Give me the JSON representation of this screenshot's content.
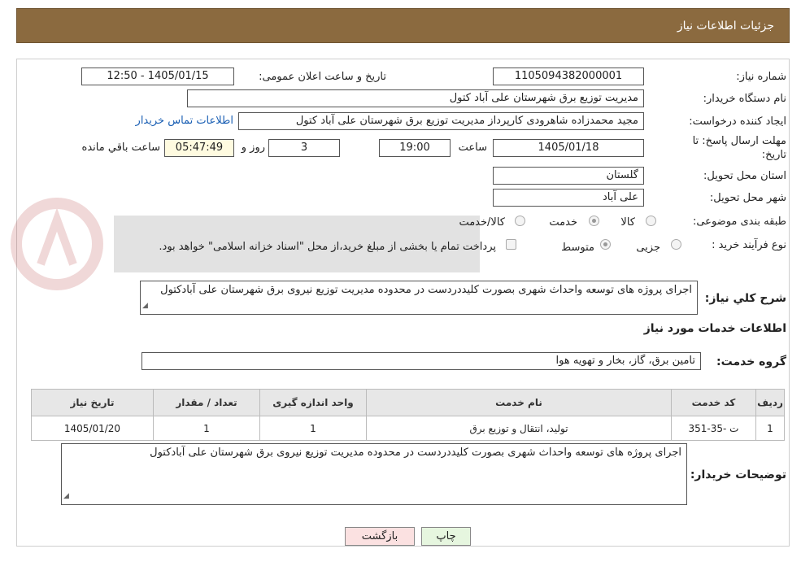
{
  "header": {
    "title": "جزئیات اطلاعات نیاز"
  },
  "form": {
    "need_number": {
      "label": "شماره نیاز:",
      "value": "1105094382000001"
    },
    "announce": {
      "label": "تاریخ و ساعت اعلان عمومی:",
      "value": "1405/01/15 - 12:50"
    },
    "buyer_org": {
      "label": "نام دستگاه خریدار:",
      "value": "مدیریت توزیع برق شهرستان علی آباد کتول"
    },
    "requester": {
      "label": "ایجاد کننده درخواست:",
      "value": "مجید محمدزاده شاهرودی کارپرداز مدیریت توزیع برق شهرستان علی آباد کتول",
      "contact_link": "اطلاعات تماس خریدار"
    },
    "deadline": {
      "label_line1": "مهلت ارسال پاسخ: تا",
      "label_line2": "تاریخ:",
      "date": "1405/01/18",
      "time_label": "ساعت",
      "time": "19:00",
      "days": "3",
      "days_label": "روز و",
      "remaining": "05:47:49",
      "remaining_label": "ساعت باقي مانده"
    },
    "province": {
      "label": "استان محل تحویل:",
      "value": "گلستان"
    },
    "city": {
      "label": "شهر محل تحویل:",
      "value": "علی آباد"
    },
    "category": {
      "label": "طبقه بندی موضوعی:",
      "options": [
        "کالا",
        "خدمت",
        "کالا/خدمت"
      ]
    },
    "purchase_type": {
      "label": "نوع فرآیند خرید :",
      "options": [
        "جزیی",
        "متوسط"
      ],
      "note": "پرداخت تمام یا بخشی از مبلغ خرید،از محل \"اسناد خزانه اسلامی\" خواهد بود."
    },
    "summary": {
      "label": "شرح کلي نياز:",
      "value": "اجرای پروژه های  توسعه واحداث شهری بصورت کلیددردست در محدوده مدیریت توزیع نیروی برق شهرستان علی آبادکتول"
    }
  },
  "services": {
    "section_title": "اطلاعات خدمات مورد نياز",
    "group_label": "گروه خدمت:",
    "group_value": "تامین برق، گاز، بخار و تهویه هوا",
    "table": {
      "headers": [
        "ردیف",
        "کد خدمت",
        "نام خدمت",
        "واحد اندازه گیری",
        "تعداد / مقدار",
        "تاریخ نیاز"
      ],
      "rows": [
        [
          "1",
          "ت -35-351",
          "تولید، انتقال و توزیع برق",
          "1",
          "1",
          "1405/01/20"
        ]
      ]
    }
  },
  "buyer_notes": {
    "label": "توضیحات خریدار:",
    "value": "اجرای پروژه های  توسعه واحداث شهری بصورت کلیددردست در محدوده مدیریت توزیع نیروی برق شهرستان علی آبادکتول"
  },
  "buttons": {
    "print": "چاپ",
    "back": "بازگشت"
  },
  "colors": {
    "header_bg": "#8b6a3f",
    "link": "#1a5fb4",
    "print_btn": "#e6f6df",
    "back_btn": "#fbe1e1"
  }
}
